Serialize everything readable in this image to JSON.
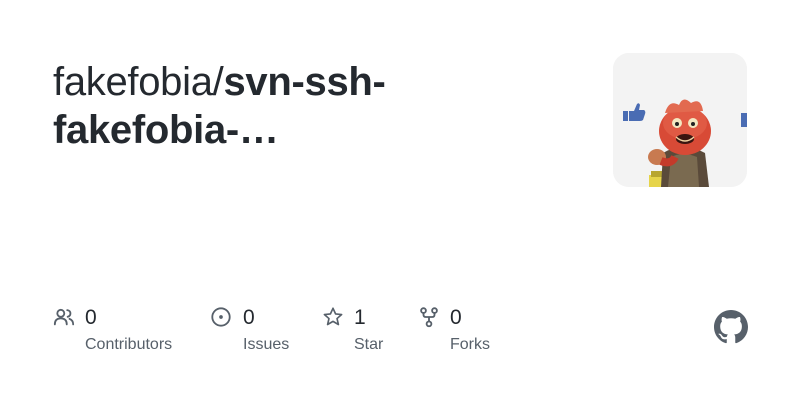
{
  "repo": {
    "owner_prefix": "fakefobia/",
    "name": "svn-ssh-fakefobia-…"
  },
  "stats": {
    "contributors": {
      "count": "0",
      "label": "Contributors",
      "icon": "people-icon"
    },
    "issues": {
      "count": "0",
      "label": "Issues",
      "icon": "issue-opened-icon"
    },
    "stars": {
      "count": "1",
      "label": "Star",
      "icon": "star-icon"
    },
    "forks": {
      "count": "0",
      "label": "Forks",
      "icon": "repo-forked-icon"
    }
  },
  "brand": {
    "logo_icon": "github-mark-icon",
    "logo_color": "#57606a"
  },
  "colors": {
    "text": "#24292f",
    "muted": "#57606a"
  }
}
